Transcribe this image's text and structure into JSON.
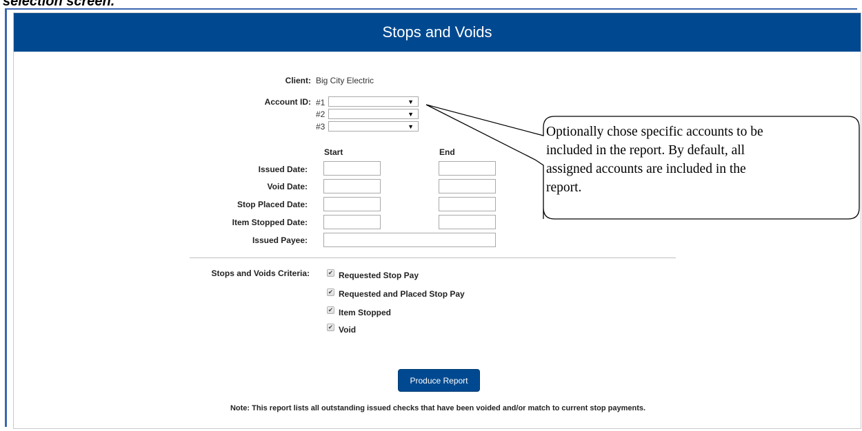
{
  "heading_fragment": "selection screen.",
  "title": "Stops and Voids",
  "client": {
    "label": "Client:",
    "value": "Big City Electric"
  },
  "account": {
    "label": "Account ID:",
    "selects": [
      {
        "number": "#1",
        "value": ""
      },
      {
        "number": "#2",
        "value": ""
      },
      {
        "number": "#3",
        "value": ""
      }
    ]
  },
  "dates": {
    "start_label": "Start",
    "end_label": "End",
    "rows": [
      {
        "label": "Issued Date:",
        "start": "",
        "end": ""
      },
      {
        "label": "Void Date:",
        "start": "",
        "end": ""
      },
      {
        "label": "Stop Placed Date:",
        "start": "",
        "end": ""
      },
      {
        "label": "Item Stopped Date:",
        "start": "",
        "end": ""
      }
    ],
    "payee_label": "Issued Payee:",
    "payee_value": ""
  },
  "criteria": {
    "label": "Stops and Voids Criteria:",
    "options": [
      {
        "label": "Requested Stop Pay",
        "checked": true
      },
      {
        "label": "Requested and Placed Stop Pay",
        "checked": true
      },
      {
        "label": "Item Stopped",
        "checked": true
      },
      {
        "label": "Void",
        "checked": true
      }
    ]
  },
  "produce_button": "Produce Report",
  "note": "Note: This report lists all outstanding issued checks that have been voided and/or match to current stop payments.",
  "callout": {
    "lines": [
      "Optionally chose specific accounts to be",
      "included in the report.  By default, all",
      "assigned accounts are included in the",
      "report."
    ]
  },
  "colors": {
    "brand": "#004990",
    "frame": "#3a66b0"
  }
}
